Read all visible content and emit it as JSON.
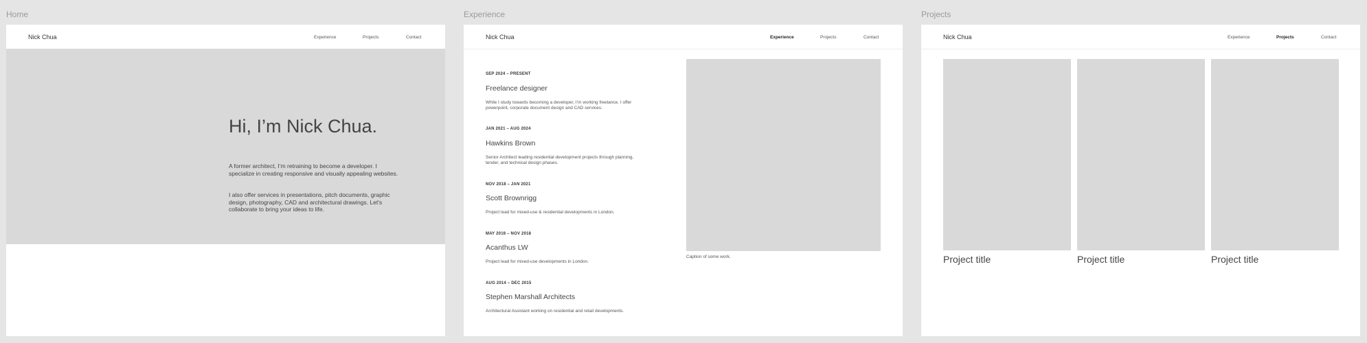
{
  "frames": {
    "home": {
      "label": "Home"
    },
    "experience": {
      "label": "Experience"
    },
    "projects": {
      "label": "Projects"
    }
  },
  "nav": {
    "brand": "Nick Chua",
    "links": [
      "Experience",
      "Projects",
      "Contact"
    ]
  },
  "home": {
    "heading": "Hi, I’m Nick Chua.",
    "paragraphs": [
      "A former architect, I’m retraining to become a developer. I specialize in creating responsive and visually appealing websites.",
      "I also offer services in presentations, pitch documents, graphic design, photography, CAD and architectural drawings. Let's collaborate to bring your ideas to life."
    ]
  },
  "experience": {
    "items": [
      {
        "date": "SEP 2024 – PRESENT",
        "title": "Freelance designer",
        "desc": "While I study towards becoming a developer, I’m working freelance. I offer powerpoint, corporate document design and CAD services."
      },
      {
        "date": "JAN 2021 – AUG 2024",
        "title": "Hawkins Brown",
        "desc": "Senior Architect leading residential development projects through planning, tender, and technical design phases."
      },
      {
        "date": "NOV 2018 – JAN 2021",
        "title": "Scott Brownrigg",
        "desc": "Project lead for mixed-use & residential developments in London."
      },
      {
        "date": "MAY 2016 – NOV 2018",
        "title": "Acanthus LW",
        "desc": "Project lead for mixed-use developments in London."
      },
      {
        "date": "AUG 2014 – DEC 2015",
        "title": "Stephen Marshall Architects",
        "desc": "Architectural Assistant working on residential and retail developments."
      }
    ],
    "caption": "Caption of some work."
  },
  "projects": {
    "cards": [
      {
        "title": "Project title"
      },
      {
        "title": "Project title"
      },
      {
        "title": "Project title"
      }
    ]
  }
}
